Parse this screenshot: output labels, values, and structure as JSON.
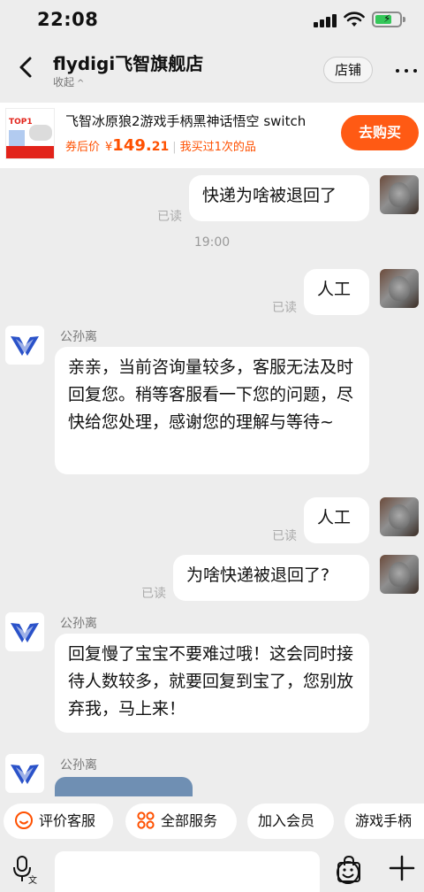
{
  "status_bar": {
    "time": "22:08"
  },
  "header": {
    "shop_name": "flydigi飞智旗舰店",
    "collapse_label": "收起",
    "store_button": "店铺"
  },
  "product": {
    "thumb_badge": "TOP1",
    "title": "飞智冰原狼2游戏手柄黑神话悟空 switch",
    "price_label": "券后价",
    "price_currency": "¥",
    "price_int": "149.",
    "price_dec": "21",
    "purchase_note": "我买过1次的品",
    "buy_button": "去购买"
  },
  "messages": {
    "m1": {
      "text": "快递为啥被退回了",
      "status": "已读"
    },
    "timestamp": "19:00",
    "m2": {
      "text": "人工",
      "status": "已读"
    },
    "m3": {
      "agent": "公孙离",
      "text": "亲亲，当前咨询量较多，客服无法及时回复您。稍等客服看一下您的问题，尽快给您处理，感谢您的理解与等待~"
    },
    "m4": {
      "text": "人工",
      "status": "已读"
    },
    "m5": {
      "text": "为啥快递被退回了?",
      "status": "已读"
    },
    "m6": {
      "agent": "公孙离",
      "text": "回复慢了宝宝不要难过哦！这会同时接待人数较多，就要回复到宝了，您别放弃我，马上来！"
    },
    "m7": {
      "agent": "公孙离"
    }
  },
  "quick_actions": [
    "评价客服",
    "全部服务",
    "加入会员",
    "游戏手柄"
  ],
  "colors": {
    "accent": "#ff5000",
    "buy_button": "#ff5a14",
    "background": "#ededed"
  }
}
